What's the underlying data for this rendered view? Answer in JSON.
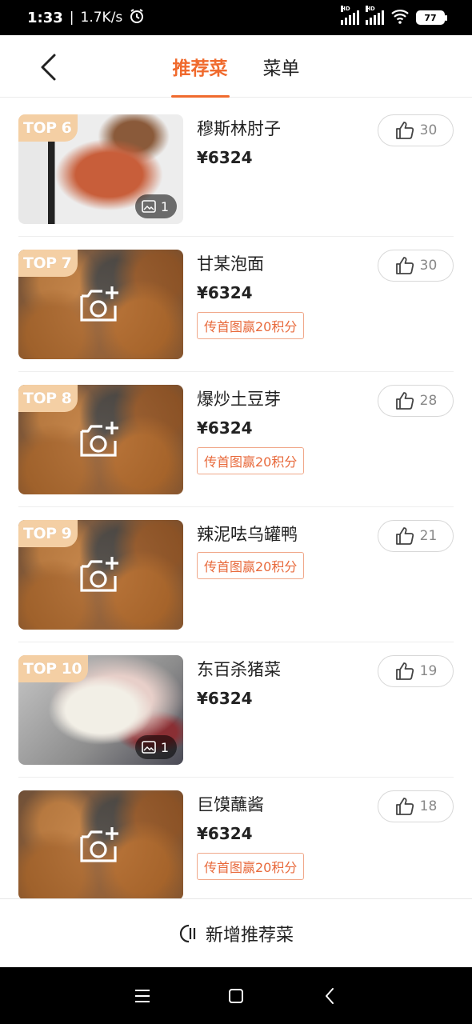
{
  "status": {
    "time": "1:33",
    "speed": "1.7K/s",
    "network1": "HD",
    "network2": "HD",
    "battery": "77"
  },
  "header": {
    "tabs": [
      {
        "label": "推荐菜",
        "active": true
      },
      {
        "label": "菜单",
        "active": false
      }
    ]
  },
  "dishes": [
    {
      "rank": "TOP 6",
      "name": "穆斯林肘子",
      "price": "¥6324",
      "likes": "30",
      "photo_count": "1",
      "promo": null,
      "image": "pork"
    },
    {
      "rank": "TOP 7",
      "name": "甘某泡面",
      "price": "¥6324",
      "likes": "30",
      "photo_count": null,
      "promo": "传首图赢20积分",
      "image": "placeholder"
    },
    {
      "rank": "TOP 8",
      "name": "爆炒土豆芽",
      "price": "¥6324",
      "likes": "28",
      "photo_count": null,
      "promo": "传首图赢20积分",
      "image": "placeholder"
    },
    {
      "rank": "TOP 9",
      "name": "辣泥呿乌罐鸭",
      "price": null,
      "likes": "21",
      "photo_count": null,
      "promo": "传首图赢20积分",
      "image": "placeholder"
    },
    {
      "rank": "TOP 10",
      "name": "东百杀猪菜",
      "price": "¥6324",
      "likes": "19",
      "photo_count": "1",
      "promo": null,
      "image": "pot"
    },
    {
      "rank": null,
      "name": "巨馍蘸酱",
      "price": "¥6324",
      "likes": "18",
      "photo_count": null,
      "promo": "传首图赢20积分",
      "image": "placeholder"
    }
  ],
  "bottom": {
    "add_label": "新增推荐菜"
  },
  "colors": {
    "accent": "#f06a2d",
    "rank_tag": "#f4cfa4",
    "promo_text": "#e86a3c"
  }
}
